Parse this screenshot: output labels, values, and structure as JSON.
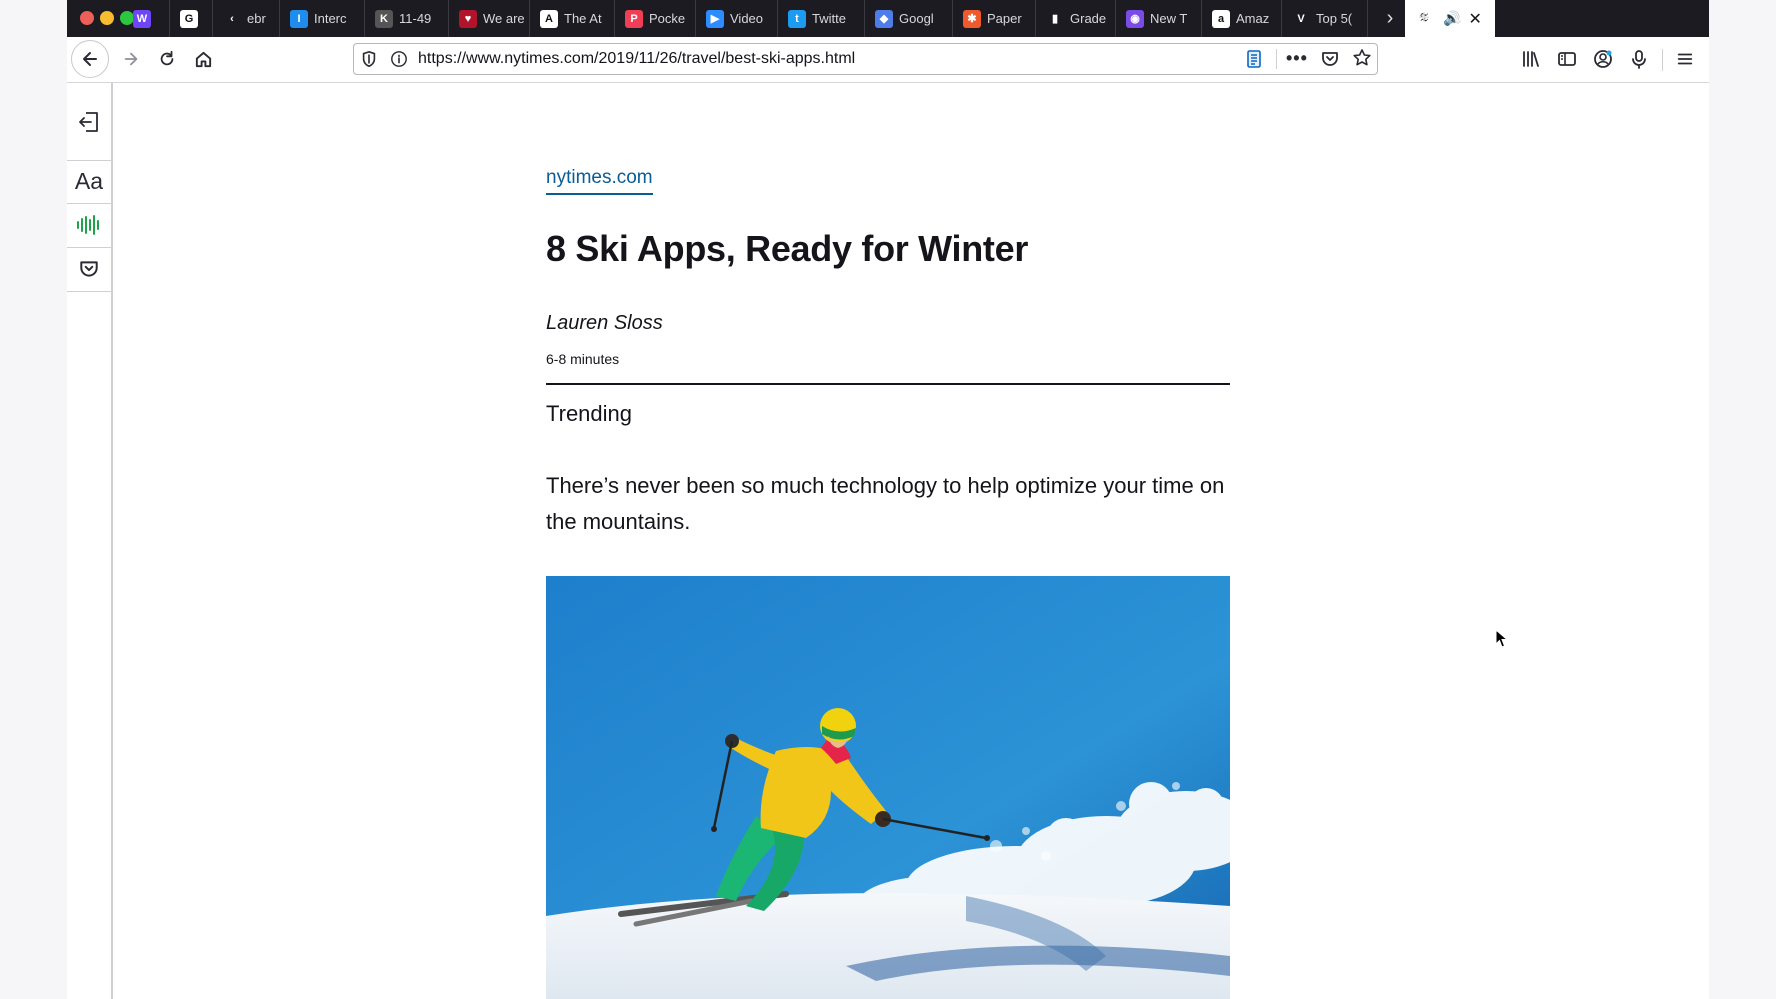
{
  "browser": {
    "tabs": [
      {
        "label": "",
        "icon": "webflow-icon",
        "color": "#6e46f5",
        "glyph": "W"
      },
      {
        "label": "",
        "icon": "google-icon",
        "color": "#ffffff",
        "glyph": "G"
      },
      {
        "label": "ebr",
        "icon": "back-chevron-icon",
        "color": "#1c1b22",
        "glyph": "‹"
      },
      {
        "label": "Interc",
        "icon": "intercom-icon",
        "color": "#1f8ded",
        "glyph": "I"
      },
      {
        "label": "11-49",
        "icon": "bookmark-icon",
        "color": "#555555",
        "glyph": "K"
      },
      {
        "label": "We are",
        "icon": "heart-icon",
        "color": "#b0132a",
        "glyph": "♥"
      },
      {
        "label": "The At",
        "icon": "atlantic-icon",
        "color": "#ffffff",
        "glyph": "A"
      },
      {
        "label": "Pocke",
        "icon": "pocket-icon",
        "color": "#ef3f56",
        "glyph": "P"
      },
      {
        "label": "Video",
        "icon": "video-icon",
        "color": "#2d8cff",
        "glyph": "▶"
      },
      {
        "label": "Twitte",
        "icon": "twitter-icon",
        "color": "#1d9bf0",
        "glyph": "t"
      },
      {
        "label": "Googl",
        "icon": "google-drive-icon",
        "color": "#4f7de8",
        "glyph": "◆"
      },
      {
        "label": "Paper",
        "icon": "paper-icon",
        "color": "#ee5a2c",
        "glyph": "✱"
      },
      {
        "label": "Grade",
        "icon": "chart-icon",
        "color": "#1c1b22",
        "glyph": "▮"
      },
      {
        "label": "New T",
        "icon": "firefox-icon",
        "color": "#7b4ce5",
        "glyph": "◉"
      },
      {
        "label": "Amaz",
        "icon": "amazon-icon",
        "color": "#ffffff",
        "glyph": "a"
      },
      {
        "label": "Top 5(",
        "icon": "v-icon",
        "color": "#1c1b22",
        "glyph": "V"
      },
      {
        "label": "",
        "icon": "nyt-icon",
        "color": "#ffffff",
        "glyph": "𝔗",
        "active": true
      }
    ],
    "url": "https://www.nytimes.com/2019/11/26/travel/best-ski-apps.html"
  },
  "reader": {
    "font_button_label": "Aa"
  },
  "article": {
    "domain": "nytimes.com",
    "title": "8 Ski Apps, Ready for Winter",
    "byline": "Lauren Sloss",
    "reading_time": "6-8 minutes",
    "section": "Trending",
    "lede": "There’s never been so much technology to help optimize your time on the mountains."
  },
  "colors": {
    "link": "#0a5c96",
    "listen_icon": "#1ea24a",
    "tabbar": "#1c1b22"
  }
}
